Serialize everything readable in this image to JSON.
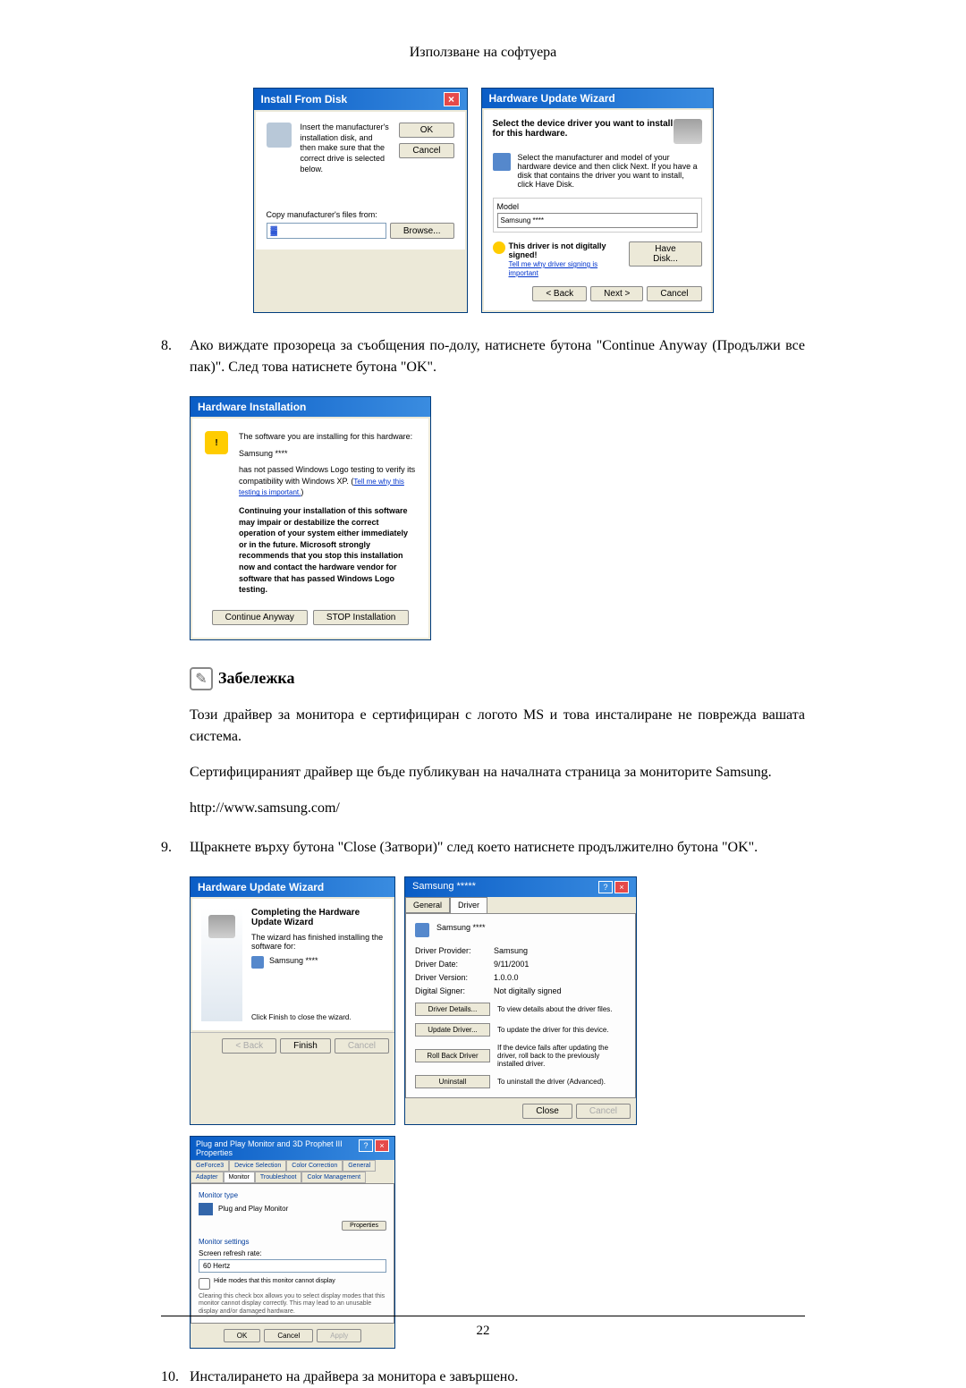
{
  "header": "Използване на софтуера",
  "installDisk": {
    "title": "Install From Disk",
    "instruction": "Insert the manufacturer's installation disk, and then make sure that the correct drive is selected below.",
    "ok": "OK",
    "cancel": "Cancel",
    "copyFrom": "Copy manufacturer's files from:",
    "browse": "Browse..."
  },
  "hwWizard": {
    "title": "Hardware Update Wizard",
    "selectDevice": "Select the device driver you want to install for this hardware.",
    "instruction": "Select the manufacturer and model of your hardware device and then click Next. If you have a disk that contains the driver you want to install, click Have Disk.",
    "modelLabel": "Model",
    "model": "Samsung ****",
    "notSigned": "This driver is not digitally signed!",
    "tellMe": "Tell me why driver signing is important",
    "haveDisk": "Have Disk...",
    "back": "< Back",
    "next": "Next >",
    "cancel": "Cancel"
  },
  "step8": {
    "num": "8.",
    "text": "Ако виждате прозореца за съобщения по-долу, натиснете бутона \"Continue Anyway (Продължи все пак)\". След това натиснете бутона \"OK\"."
  },
  "hwInstall": {
    "title": "Hardware Installation",
    "line1": "The software you are installing for this hardware:",
    "device": "Samsung ****",
    "line2": "has not passed Windows Logo testing to verify its compatibility with Windows XP. (",
    "tellMe": "Tell me why this testing is important.",
    "line2end": ")",
    "warning": "Continuing your installation of this software may impair or destabilize the correct operation of your system either immediately or in the future. Microsoft strongly recommends that you stop this installation now and contact the hardware vendor for software that has passed Windows Logo testing.",
    "continue": "Continue Anyway",
    "stop": "STOP Installation"
  },
  "note": {
    "title": "Забележка",
    "para1": "Този драйвер за монитора е сертифициран с логото MS и това инсталиране не поврежда вашата система.",
    "para2": "Сертифицираният драйвер ще бъде публикуван на началната страница за мониторите Samsung.",
    "url": "http://www.samsung.com/"
  },
  "step9": {
    "num": "9.",
    "text": "Щракнете върху бутона \"Close (Затвори)\" след което натиснете продължително бутона \"OK\"."
  },
  "completeWizard": {
    "title": "Hardware Update Wizard",
    "heading": "Completing the Hardware Update Wizard",
    "finished": "The wizard has finished installing the software for:",
    "device": "Samsung ****",
    "clickFinish": "Click Finish to close the wizard.",
    "back": "< Back",
    "finish": "Finish",
    "cancel": "Cancel"
  },
  "driverProps": {
    "title": "Samsung *****",
    "tabGeneral": "General",
    "tabDriver": "Driver",
    "device": "Samsung ****",
    "providerLabel": "Driver Provider:",
    "provider": "Samsung",
    "dateLabel": "Driver Date:",
    "date": "9/11/2001",
    "versionLabel": "Driver Version:",
    "version": "1.0.0.0",
    "signerLabel": "Digital Signer:",
    "signer": "Not digitally signed",
    "detailsBtn": "Driver Details...",
    "detailsDesc": "To view details about the driver files.",
    "updateBtn": "Update Driver...",
    "updateDesc": "To update the driver for this device.",
    "rollbackBtn": "Roll Back Driver",
    "rollbackDesc": "If the device fails after updating the driver, roll back to the previously installed driver.",
    "uninstallBtn": "Uninstall",
    "uninstallDesc": "To uninstall the driver (Advanced).",
    "close": "Close",
    "cancel": "Cancel"
  },
  "monitorProps": {
    "title": "Plug and Play Monitor and 3D Prophet III Properties",
    "tabs": {
      "geforce": "GeForce3",
      "device": "Device Selection",
      "color": "Color Correction",
      "general": "General",
      "adapter": "Adapter",
      "monitor": "Monitor",
      "trouble": "Troubleshoot",
      "colorMgmt": "Color Management"
    },
    "monitorType": "Monitor type",
    "pnp": "Plug and Play Monitor",
    "properties": "Properties",
    "settings": "Monitor settings",
    "refreshLabel": "Screen refresh rate:",
    "refresh": "60 Hertz",
    "hideCheck": "Hide modes that this monitor cannot display",
    "hideNote": "Clearing this check box allows you to select display modes that this monitor cannot display correctly. This may lead to an unusable display and/or damaged hardware.",
    "ok": "OK",
    "cancel": "Cancel",
    "apply": "Apply"
  },
  "step10": {
    "num": "10.",
    "text": "Инсталирането на драйвера за монитора е завършено."
  },
  "pageNum": "22"
}
